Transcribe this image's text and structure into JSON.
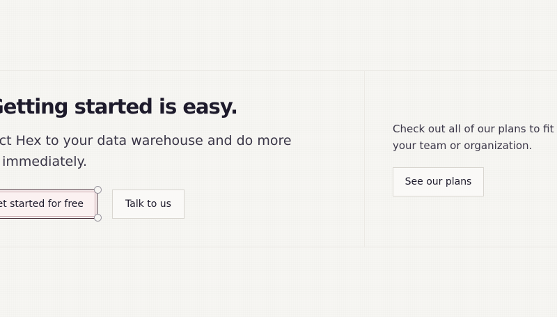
{
  "cta": {
    "heading": "Getting started is easy.",
    "lead": "Connect Hex to your data warehouse and do more with it immediately.",
    "primary_button": "Get started for free",
    "secondary_button": "Talk to us"
  },
  "plans": {
    "text": "Check out all of our plans to fit your team or organization.",
    "button": "See our plans"
  }
}
